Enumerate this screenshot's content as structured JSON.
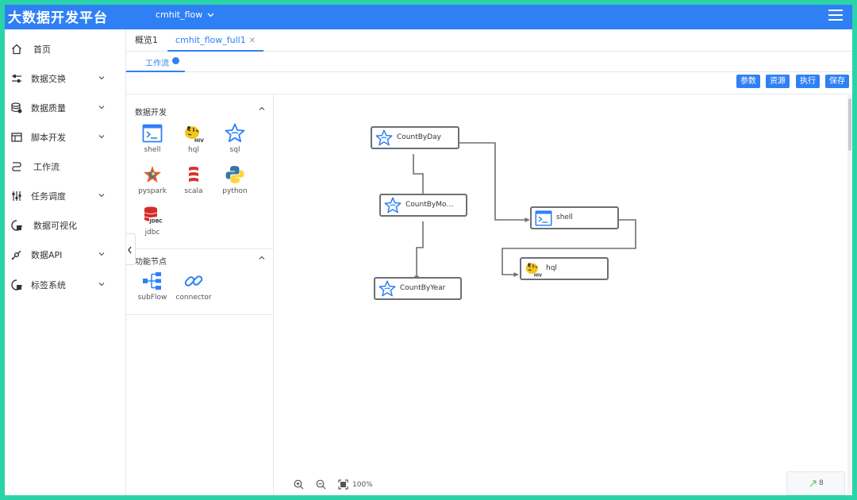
{
  "header": {
    "app_title": "大数据开发平台",
    "project": "cmhit_flow",
    "brand_color": "#2f80f5"
  },
  "sidebar": {
    "items": [
      {
        "label": "首页",
        "icon": "home-icon",
        "has_arrow": false
      },
      {
        "label": "数据交换",
        "icon": "sliders-icon",
        "has_arrow": true
      },
      {
        "label": "数据质量",
        "icon": "database-check-icon",
        "has_arrow": true
      },
      {
        "label": "脚本开发",
        "icon": "script-icon",
        "has_arrow": true
      },
      {
        "label": "工作流",
        "icon": "workflow-icon",
        "has_arrow": false
      },
      {
        "label": "任务调度",
        "icon": "schedule-icon",
        "has_arrow": true
      },
      {
        "label": "数据可视化",
        "icon": "chart-icon",
        "has_arrow": false
      },
      {
        "label": "数据API",
        "icon": "api-icon",
        "has_arrow": true
      },
      {
        "label": "标签系统",
        "icon": "tag-icon",
        "has_arrow": true
      }
    ]
  },
  "tabs": [
    {
      "label": "概览1",
      "active": false
    },
    {
      "label": "cmhit_flow_full1",
      "active": true,
      "closable": true
    }
  ],
  "subtab": {
    "label": "工作流"
  },
  "toolbar": {
    "params": "参数",
    "resources": "资源",
    "run": "执行",
    "save": "保存"
  },
  "palette": {
    "data_dev": {
      "title": "数据开发",
      "nodes": [
        {
          "label": "shell",
          "icon": "shell-icon"
        },
        {
          "label": "hql",
          "icon": "hive-icon"
        },
        {
          "label": "sql",
          "icon": "sql-star-icon"
        },
        {
          "label": "pyspark",
          "icon": "pyspark-icon"
        },
        {
          "label": "scala",
          "icon": "scala-icon"
        },
        {
          "label": "python",
          "icon": "python-icon"
        },
        {
          "label": "jdbc",
          "icon": "jdbc-icon"
        }
      ]
    },
    "func_nodes": {
      "title": "功能节点",
      "nodes": [
        {
          "label": "subFlow",
          "icon": "subflow-icon"
        },
        {
          "label": "connector",
          "icon": "connector-icon"
        }
      ]
    }
  },
  "flow": {
    "nodes": [
      {
        "id": "n1",
        "label": "CountByDay",
        "icon": "sql-star-icon"
      },
      {
        "id": "n2",
        "label": "CountByMo…",
        "icon": "sql-star-icon"
      },
      {
        "id": "n3",
        "label": "shell",
        "icon": "shell-icon"
      },
      {
        "id": "n4",
        "label": "hql",
        "icon": "hive-icon"
      },
      {
        "id": "n5",
        "label": "CountByYear",
        "icon": "sql-star-icon"
      }
    ],
    "edges": [
      {
        "from": "CountByDay",
        "to": "CountByMo…"
      },
      {
        "from": "CountByDay",
        "to": "shell"
      },
      {
        "from": "CountByMo…",
        "to": "CountByYear"
      },
      {
        "from": "shell",
        "to": "hql"
      }
    ]
  },
  "canvas": {
    "zoom": "100%"
  },
  "minimap": {
    "count": "8"
  }
}
